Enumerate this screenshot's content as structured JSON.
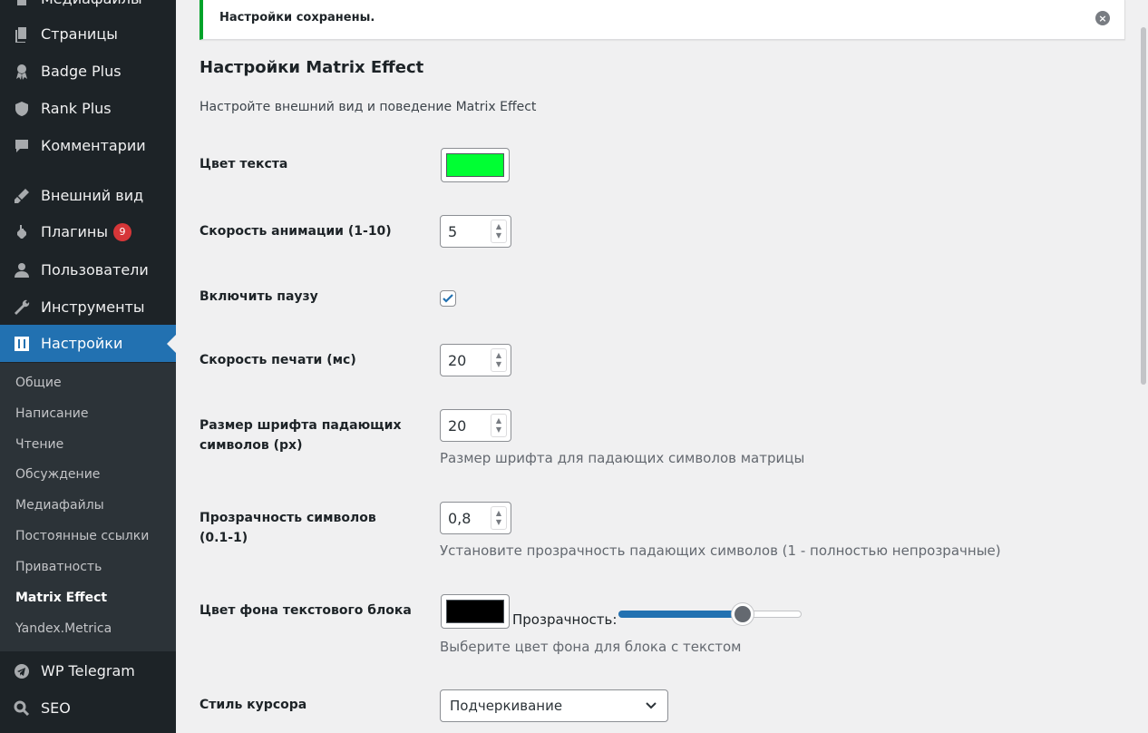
{
  "sidebar": {
    "items": [
      {
        "label": "Медиафайлы",
        "icon": "media-icon"
      },
      {
        "label": "Страницы",
        "icon": "pages-icon"
      },
      {
        "label": "Badge Plus",
        "icon": "badge-icon"
      },
      {
        "label": "Rank Plus",
        "icon": "shield-icon"
      },
      {
        "label": "Комментарии",
        "icon": "comments-icon"
      },
      {
        "label": "Внешний вид",
        "icon": "appearance-brush-icon"
      },
      {
        "label": "Плагины",
        "icon": "plugins-icon",
        "badge": "9"
      },
      {
        "label": "Пользователи",
        "icon": "users-icon"
      },
      {
        "label": "Инструменты",
        "icon": "tools-wrench-icon"
      },
      {
        "label": "Настройки",
        "icon": "settings-icon"
      },
      {
        "label": "WP Telegram",
        "icon": "telegram-icon"
      },
      {
        "label": "SEO",
        "icon": "search-icon"
      }
    ],
    "submenu": [
      "Общие",
      "Написание",
      "Чтение",
      "Обсуждение",
      "Медиафайлы",
      "Постоянные ссылки",
      "Приватность",
      "Matrix Effect",
      "Yandex.Metrica"
    ]
  },
  "notice": {
    "message": "Настройки сохранены.",
    "dismiss": "×"
  },
  "page": {
    "title": "Настройки Matrix Effect",
    "description": "Настройте внешний вид и поведение Matrix Effect"
  },
  "fields": {
    "text_color": {
      "label": "Цвет текста",
      "value": "#00ff33"
    },
    "anim_speed": {
      "label": "Скорость анимации (1-10)",
      "value": "5"
    },
    "pause": {
      "label": "Включить паузу",
      "checked": true
    },
    "type_speed": {
      "label": "Скорость печати (мс)",
      "value": "20"
    },
    "font_size": {
      "label_line1": "Размер шрифта падающих",
      "label_line2": "символов (px)",
      "value": "20",
      "description": "Размер шрифта для падающих символов матрицы"
    },
    "opacity": {
      "label_line1": "Прозрачность символов",
      "label_line2": "(0.1-1)",
      "value": "0,8",
      "description": "Установите прозрачность падающих символов (1 - полностью непрозрачные)"
    },
    "bg_color": {
      "label": "Цвет фона текстового блока",
      "value": "#000000",
      "opacity_label": "Прозрачность:",
      "opacity_level": 0.68,
      "description": "Выберите цвет фона для блока с текстом"
    },
    "cursor_style": {
      "label": "Стиль курсора",
      "value": "Подчеркивание"
    }
  },
  "colors": {
    "accent": "#2271b1",
    "sidebar": "#1d2327",
    "submenu": "#2c3338",
    "notice_success": "#00a32a",
    "badge": "#d63638"
  }
}
